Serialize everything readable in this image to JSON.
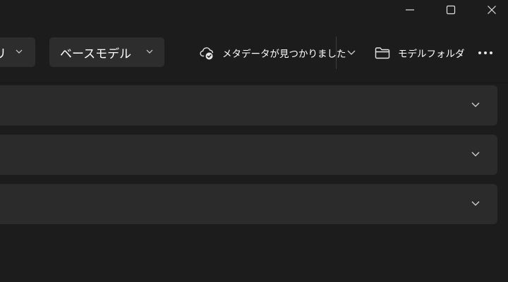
{
  "window_controls": {
    "minimize_icon": "minimize-icon",
    "maximize_icon": "maximize-icon",
    "close_icon": "close-icon"
  },
  "toolbar": {
    "category_dropdown_label": "リ",
    "base_model_dropdown_label": "ベースモデル",
    "metadata_status_label": "メタデータが見つかりました",
    "model_folder_label": "モデルフォルダ",
    "more_icon": "more-horizontal-icon"
  },
  "panels": [
    {
      "chevron_icon": "chevron-down-icon"
    },
    {
      "chevron_icon": "chevron-down-icon"
    },
    {
      "chevron_icon": "chevron-down-icon"
    }
  ],
  "colors": {
    "background": "#1c1c1c",
    "surface": "#2d2d2d",
    "panel": "#2b2b2b",
    "text": "#ffffff",
    "icon": "#d6d6d6"
  }
}
